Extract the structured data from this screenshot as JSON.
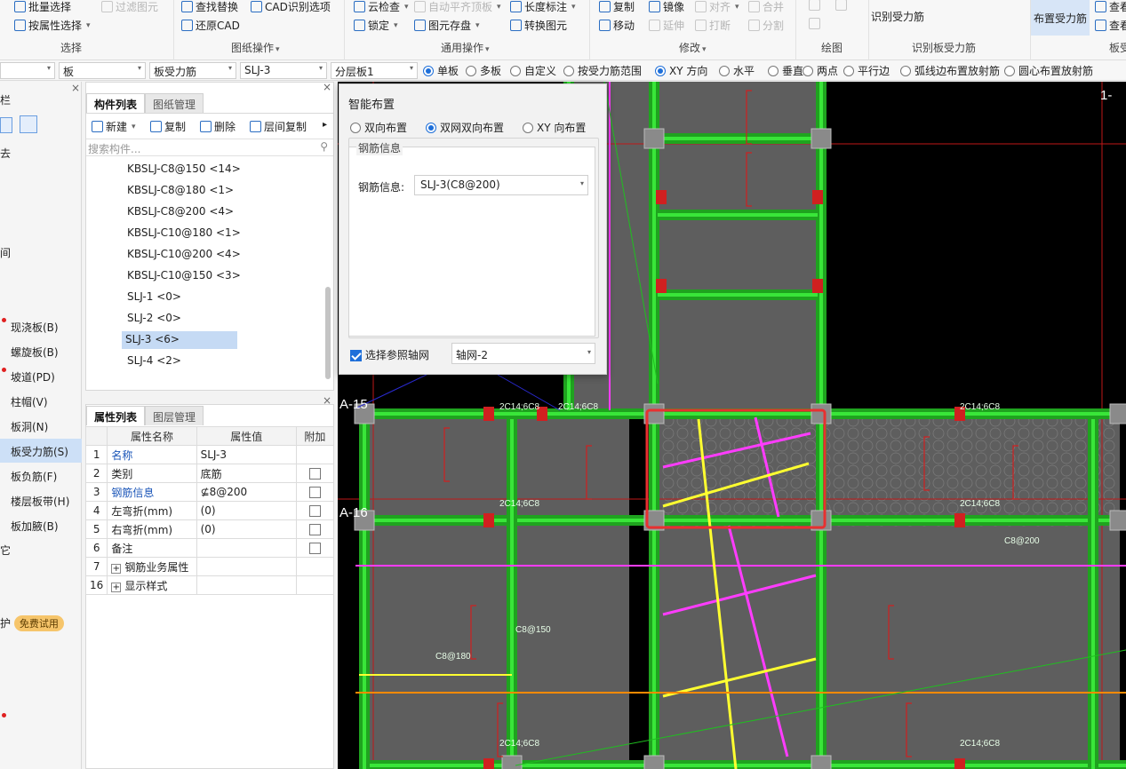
{
  "ribbon": {
    "select_group": {
      "batch_select": "批量选择",
      "filter_elements": "过滤图元",
      "select_by_attr": "按属性选择",
      "label": "选择"
    },
    "drawing_ops": {
      "find_replace": "查找替换",
      "cad_options": "CAD识别选项",
      "restore_cad": "还原CAD",
      "label": "图纸操作"
    },
    "general_ops": {
      "cloud_check": "云检查",
      "auto_align": "自动平齐顶板",
      "length_dim": "长度标注",
      "lock": "锁定",
      "save_elements": "图元存盘",
      "convert_elements": "转换图元",
      "label": "通用操作"
    },
    "modify": {
      "copy": "复制",
      "mirror": "镜像",
      "align": "对齐",
      "merge": "合并",
      "move": "移动",
      "extend": "延伸",
      "break": "打断",
      "split": "分割",
      "label": "修改"
    },
    "draw": {
      "label": "绘图"
    },
    "recognize": {
      "identify_slab_rebar": "识别受力筋",
      "label": "识别板受力筋"
    },
    "slab_rebar": {
      "place_rebar": "布置受力筋",
      "query": "查看",
      "query2": "查看",
      "label": "板受"
    }
  },
  "propbar": {
    "dd1": "",
    "dd2": "板",
    "dd3": "板受力筋",
    "dd4": "SLJ-3",
    "dd5": "分层板1",
    "options": [
      {
        "label": "单板",
        "on": true
      },
      {
        "label": "多板",
        "on": false
      },
      {
        "label": "自定义",
        "on": false
      },
      {
        "label": "按受力筋范围",
        "on": false
      },
      {
        "label": "XY 方向",
        "on": true
      },
      {
        "label": "水平",
        "on": false
      },
      {
        "label": "垂直",
        "on": false
      },
      {
        "label": "两点",
        "on": false
      },
      {
        "label": "平行边",
        "on": false
      },
      {
        "label": "弧线边布置放射筋",
        "on": false
      },
      {
        "label": "圆心布置放射筋",
        "on": false
      }
    ]
  },
  "leftnav": {
    "top_label": "栏",
    "items": [
      {
        "label": "现浇板(B)",
        "dot": true,
        "sel": false
      },
      {
        "label": "螺旋板(B)",
        "dot": false,
        "sel": false
      },
      {
        "label": "坡道(PD)",
        "dot": true,
        "sel": false
      },
      {
        "label": "柱帽(V)",
        "dot": false,
        "sel": false
      },
      {
        "label": "板洞(N)",
        "dot": false,
        "sel": false
      },
      {
        "label": "板受力筋(S)",
        "dot": false,
        "sel": true
      },
      {
        "label": "板负筋(F)",
        "dot": false,
        "sel": false
      },
      {
        "label": "楼层板带(H)",
        "dot": false,
        "sel": false
      },
      {
        "label": "板加腋(B)",
        "dot": false,
        "sel": false
      }
    ],
    "misc_a": "去",
    "misc_b": "间",
    "misc_c": "它",
    "protect": "护",
    "free_trial": "免费试用"
  },
  "complist": {
    "tab_components": "构件列表",
    "tab_drawings": "图纸管理",
    "new": "新建",
    "copy": "复制",
    "delete": "删除",
    "floor_copy": "层间复制",
    "search_placeholder": "搜索构件...",
    "items": [
      "KBSLJ-C8@150 <14>",
      "KBSLJ-C8@180 <1>",
      "KBSLJ-C8@200 <4>",
      "KBSLJ-C10@180 <1>",
      "KBSLJ-C10@200 <4>",
      "KBSLJ-C10@150 <3>",
      "SLJ-1 <0>",
      "SLJ-2 <0>",
      "SLJ-3 <6>",
      "SLJ-4 <2>"
    ],
    "selected_index": 8
  },
  "propgrid": {
    "tab_props": "属性列表",
    "tab_layers": "图层管理",
    "headers": [
      "",
      "属性名称",
      "属性值",
      "附加"
    ],
    "rows": [
      {
        "no": "1",
        "name": "名称",
        "value": "SLJ-3",
        "blue": true,
        "cb": false
      },
      {
        "no": "2",
        "name": "类别",
        "value": "底筋",
        "blue": false,
        "cb": true
      },
      {
        "no": "3",
        "name": "钢筋信息",
        "value": "⊈8@200",
        "blue": true,
        "cb": true
      },
      {
        "no": "4",
        "name": "左弯折(mm)",
        "value": "(0)",
        "blue": false,
        "cb": true
      },
      {
        "no": "5",
        "name": "右弯折(mm)",
        "value": "(0)",
        "blue": false,
        "cb": true
      },
      {
        "no": "6",
        "name": "备注",
        "value": "",
        "blue": false,
        "cb": true
      },
      {
        "no": "7",
        "name": "钢筋业务属性",
        "value": "",
        "blue": false,
        "cb": false,
        "expand": true
      },
      {
        "no": "16",
        "name": "显示样式",
        "value": "",
        "blue": false,
        "cb": false,
        "expand": true
      }
    ]
  },
  "dialog": {
    "title": "智能布置",
    "modes": [
      {
        "label": "双向布置",
        "on": false
      },
      {
        "label": "双网双向布置",
        "on": true
      },
      {
        "label": "XY 向布置",
        "on": false
      }
    ],
    "rebar_group": "钢筋信息",
    "rebar_label": "钢筋信息:",
    "rebar_value": "SLJ-3(C8@200)",
    "ref_axis_label": "选择参照轴网",
    "ref_axis_checked": true,
    "axis_value": "轴网-2"
  },
  "canvas": {
    "axis_labels": [
      "A-15",
      "A-16",
      "1-"
    ],
    "annot": [
      "2C14;6C8",
      "2C14;6C8",
      "2C14;6C8",
      "2C14;6C8",
      "2C14;6C8",
      "2C14;6C8",
      "2C14;6C8",
      "C8@200",
      "C8@150",
      "C8@180"
    ],
    "colors": {
      "bg": "#000000",
      "slab": "#5e5e5e",
      "beam": "#39e639",
      "rebar": "#ff3cff",
      "rebar2": "#ffff30",
      "select": "#e83030",
      "grid": "#c01818"
    }
  }
}
